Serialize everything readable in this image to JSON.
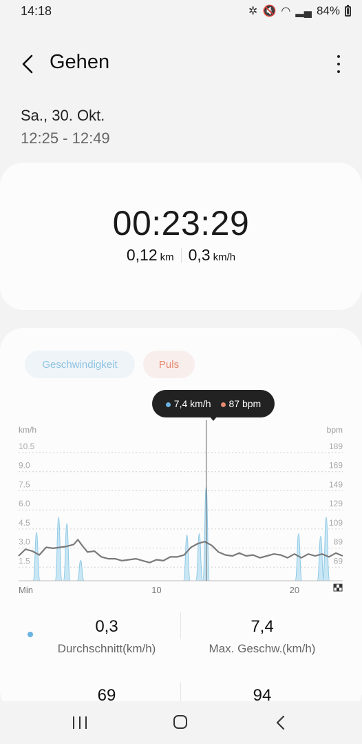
{
  "status_bar": {
    "time": "14:18",
    "battery": "84%"
  },
  "header": {
    "title": "Gehen"
  },
  "session": {
    "date": "Sa., 30. Okt.",
    "time_range": "12:25 - 12:49"
  },
  "summary": {
    "duration": "00:23:29",
    "distance_value": "0,12",
    "distance_unit": "km",
    "speed_value": "0,3",
    "speed_unit": "km/h"
  },
  "tabs": {
    "speed": "Geschwindigkeit",
    "pulse": "Puls"
  },
  "tooltip": {
    "speed": "7,4 km/h",
    "pulse": "87 bpm"
  },
  "colors": {
    "speed": "#8fc9e6",
    "pulse": "#7a7a7a",
    "pulse_accent": "#e6896f"
  },
  "chart_data": {
    "type": "area",
    "left_axis_label": "km/h",
    "right_axis_label": "bpm",
    "left_ticks": [
      "10.5",
      "9.0",
      "7.5",
      "6.0",
      "4.5",
      "3.0",
      "1.5"
    ],
    "right_ticks": [
      "189",
      "169",
      "149",
      "129",
      "109",
      "89",
      "69"
    ],
    "x_ticks": [
      "Min",
      "10",
      "20"
    ],
    "xlim": [
      0,
      23.5
    ],
    "ylim_left": [
      0,
      10.5
    ],
    "ylim_right": [
      49,
      189
    ],
    "series": [
      {
        "name": "Geschwindigkeit",
        "axis": "left",
        "peaks": [
          [
            1.3,
            3.8
          ],
          [
            2.9,
            5.0
          ],
          [
            3.5,
            4.5
          ],
          [
            4.5,
            1.6
          ],
          [
            12.2,
            3.6
          ],
          [
            13.1,
            3.7
          ],
          [
            13.6,
            7.4
          ],
          [
            20.3,
            3.7
          ],
          [
            21.9,
            3.5
          ],
          [
            22.3,
            5.0
          ]
        ]
      },
      {
        "name": "Puls",
        "axis": "right",
        "points": [
          [
            0,
            75
          ],
          [
            0.5,
            82
          ],
          [
            1,
            80
          ],
          [
            1.5,
            76
          ],
          [
            2,
            84
          ],
          [
            2.5,
            83
          ],
          [
            3,
            84
          ],
          [
            3.5,
            85
          ],
          [
            4,
            87
          ],
          [
            4.3,
            92
          ],
          [
            4.6,
            86
          ],
          [
            5,
            79
          ],
          [
            5.5,
            80
          ],
          [
            6,
            74
          ],
          [
            6.5,
            72
          ],
          [
            7,
            72
          ],
          [
            7.5,
            70
          ],
          [
            8,
            71
          ],
          [
            8.5,
            72
          ],
          [
            9,
            70
          ],
          [
            9.5,
            68
          ],
          [
            10,
            71
          ],
          [
            10.5,
            70
          ],
          [
            11,
            74
          ],
          [
            11.5,
            74
          ],
          [
            12,
            76
          ],
          [
            12.5,
            84
          ],
          [
            13,
            88
          ],
          [
            13.5,
            90
          ],
          [
            14,
            86
          ],
          [
            14.5,
            79
          ],
          [
            15,
            76
          ],
          [
            15.5,
            75
          ],
          [
            16,
            78
          ],
          [
            16.5,
            75
          ],
          [
            17,
            76
          ],
          [
            17.5,
            73
          ],
          [
            18,
            75
          ],
          [
            18.5,
            77
          ],
          [
            19,
            76
          ],
          [
            19.5,
            73
          ],
          [
            20,
            77
          ],
          [
            20.5,
            73
          ],
          [
            21,
            77
          ],
          [
            21.5,
            75
          ],
          [
            22,
            77
          ],
          [
            22.5,
            74
          ],
          [
            23,
            78
          ],
          [
            23.5,
            75
          ]
        ]
      }
    ],
    "cursor_x": 13.6
  },
  "stats": [
    {
      "value": "0,3",
      "label": "Durchschnitt(km/h)"
    },
    {
      "value": "7,4",
      "label": "Max. Geschw.(km/h)"
    },
    {
      "value": "69",
      "label": ""
    },
    {
      "value": "94",
      "label": ""
    }
  ]
}
